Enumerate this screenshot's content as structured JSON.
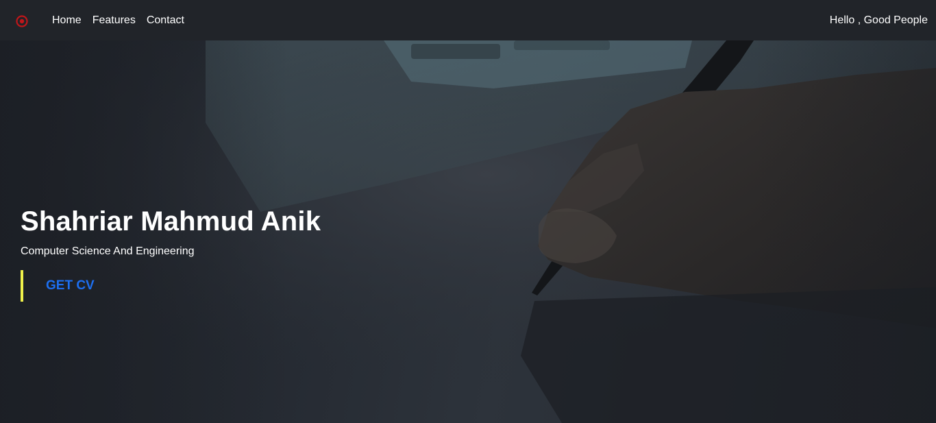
{
  "navbar": {
    "logo_icon": "target-icon",
    "logo_color": "#c0161a",
    "links": [
      {
        "label": "Home"
      },
      {
        "label": "Features"
      },
      {
        "label": "Contact"
      }
    ],
    "greeting": "Hello , Good People"
  },
  "hero": {
    "name": "Shahriar Mahmud Anik",
    "subtitle": "Computer Science And Engineering",
    "cta_label": "GET CV",
    "cta_accent_color": "#eef04a",
    "cta_text_color": "#1d6ff0"
  }
}
